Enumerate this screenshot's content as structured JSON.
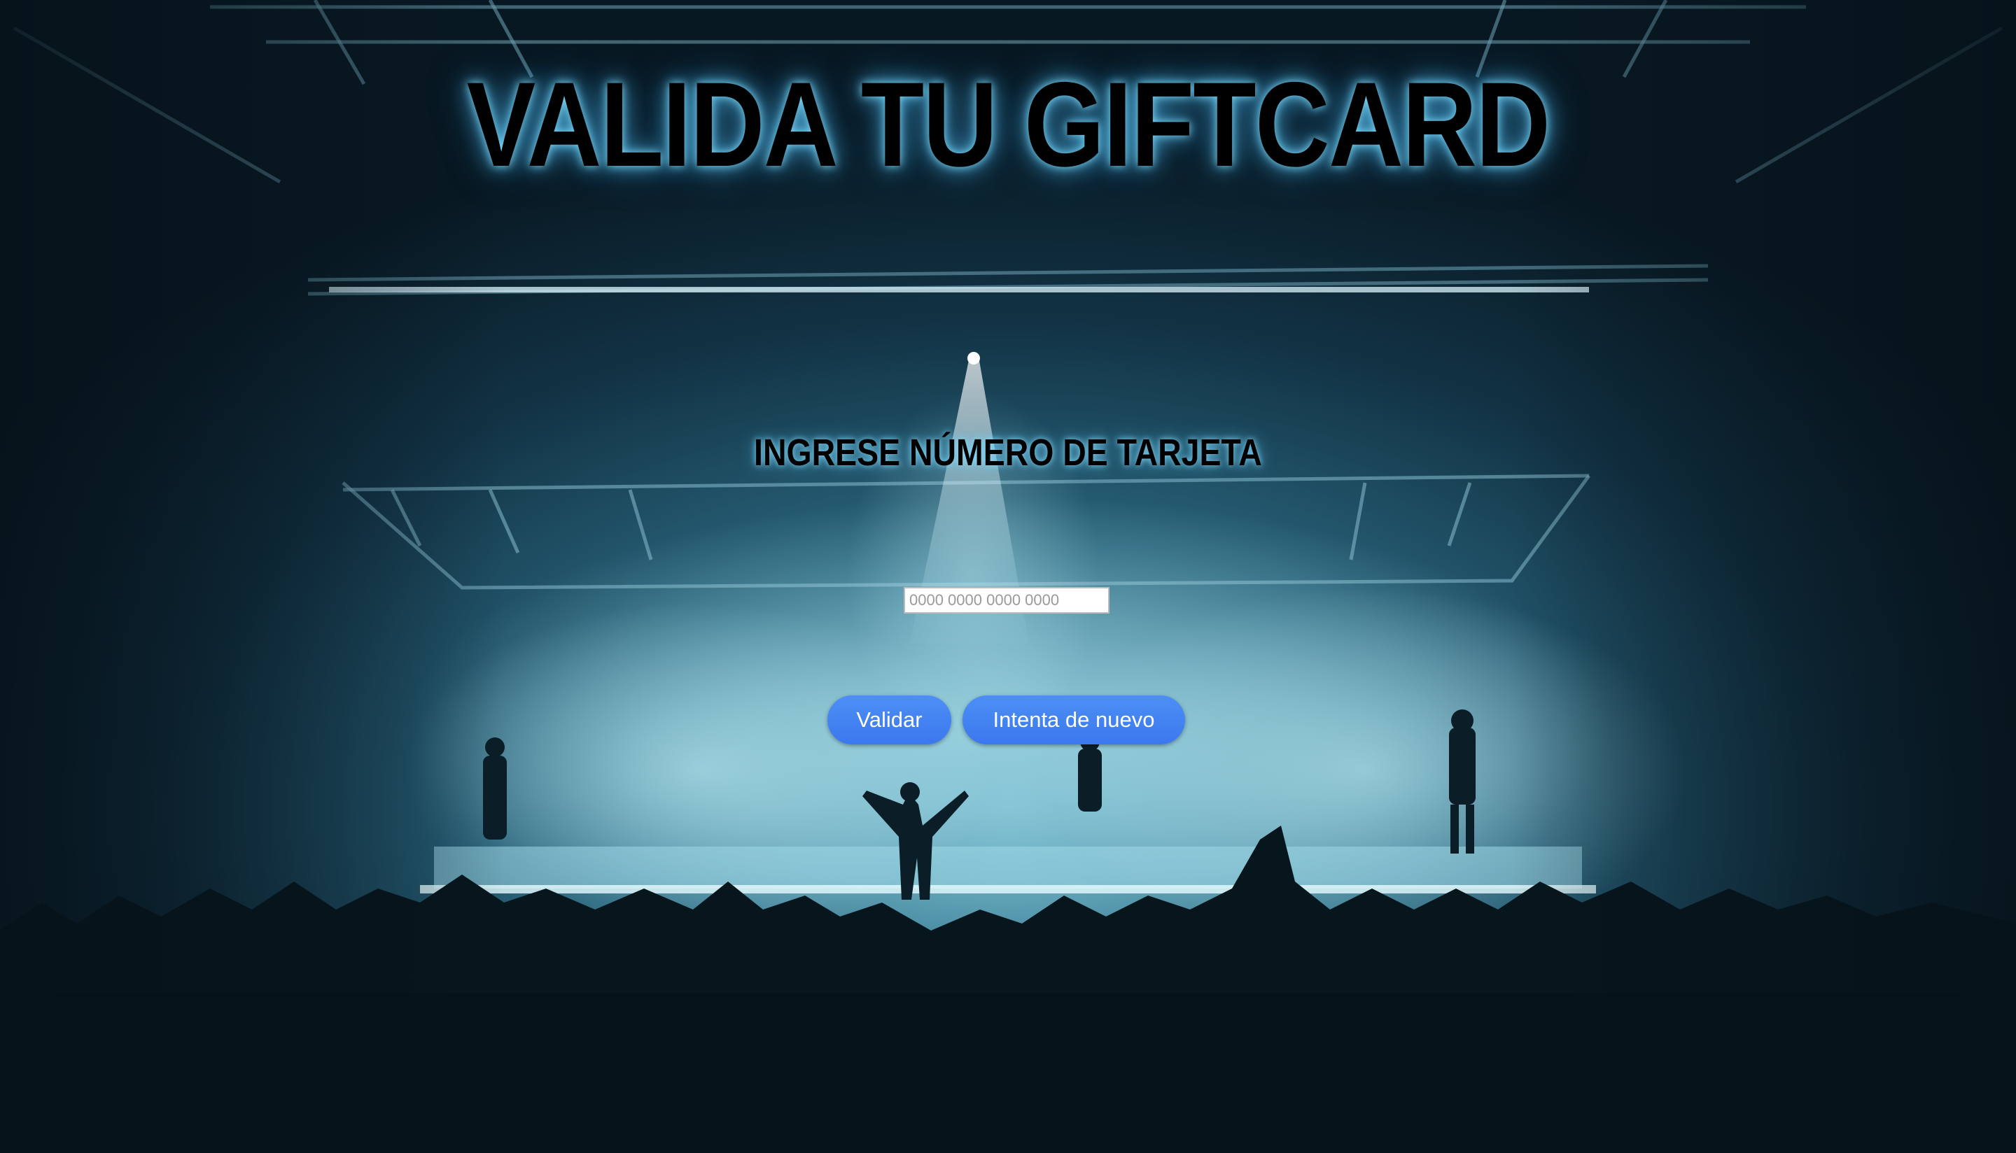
{
  "page": {
    "title": "VALIDA TU GIFTCARD",
    "subtitle": "INGRESE NÚMERO DE TARJETA"
  },
  "form": {
    "card_number_value": "",
    "card_number_placeholder": "0000 0000 0000 0000",
    "validate_label": "Validar",
    "retry_label": "Intenta de nuevo"
  },
  "colors": {
    "button": "#3f7ff0",
    "title_glow": "#7fd8ff",
    "background": "#0b1a24"
  }
}
